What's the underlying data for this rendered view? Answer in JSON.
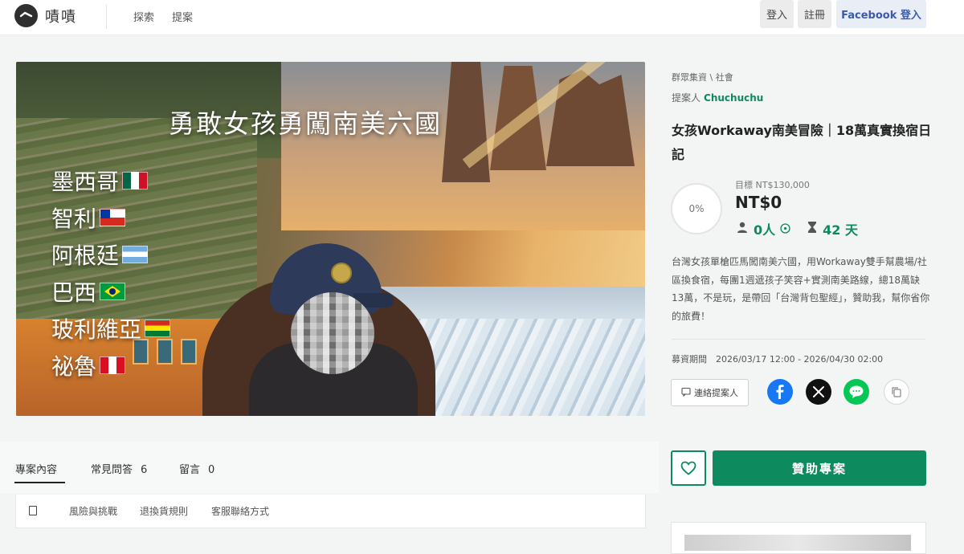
{
  "header": {
    "brand": "嘖嘖",
    "nav": [
      "探索",
      "提案"
    ],
    "login": "登入",
    "register": "註冊",
    "facebook_login": "Facebook 登入"
  },
  "hero": {
    "title": "勇敢女孩勇闖南美六國",
    "countries": [
      {
        "name": "墨西哥",
        "flag": "mexico-flag"
      },
      {
        "name": "智利",
        "flag": "chile-flag"
      },
      {
        "name": "阿根廷",
        "flag": "argentina-flag"
      },
      {
        "name": "巴西",
        "flag": "brazil-flag"
      },
      {
        "name": "玻利維亞",
        "flag": "bolivia-flag"
      },
      {
        "name": "祕魯",
        "flag": "peru-flag"
      }
    ]
  },
  "project": {
    "breadcrumb": "群眾集資 \\ 社會",
    "proposer_label": "提案人",
    "proposer_name": "Chuchuchu",
    "title": "女孩Workaway南美冒險｜18萬真實換宿日記",
    "progress": "0%",
    "goal_label": "目標 NT$130,000",
    "raised": "NT$0",
    "backers": "0人",
    "days_left": "42 天",
    "description": "台灣女孩單槍匹馬闖南美六國，用Workaway雙手幫農場/社區換食宿，每團1週遞孩子笑容+實測南美路線，總18萬缺13萬，不是玩，是帶回「台灣背包聖經」，贊助我，幫你省你的旅費！",
    "period": "募資期間　2026/03/17 12:00 - 2026/04/30 02:00",
    "contact_button": "連絡提案人"
  },
  "tabs": [
    {
      "label": "專案內容",
      "count": ""
    },
    {
      "label": "常見問答",
      "count": "6"
    },
    {
      "label": "留言",
      "count": "0"
    }
  ],
  "subnav": [
    "風險與挑戰",
    "退換貨規則",
    "客服聯絡方式"
  ],
  "actions": {
    "support_button": "贊助專案"
  },
  "colors": {
    "accent": "#0e8a5f",
    "facebook": "#1877f2",
    "line": "#06c755"
  }
}
